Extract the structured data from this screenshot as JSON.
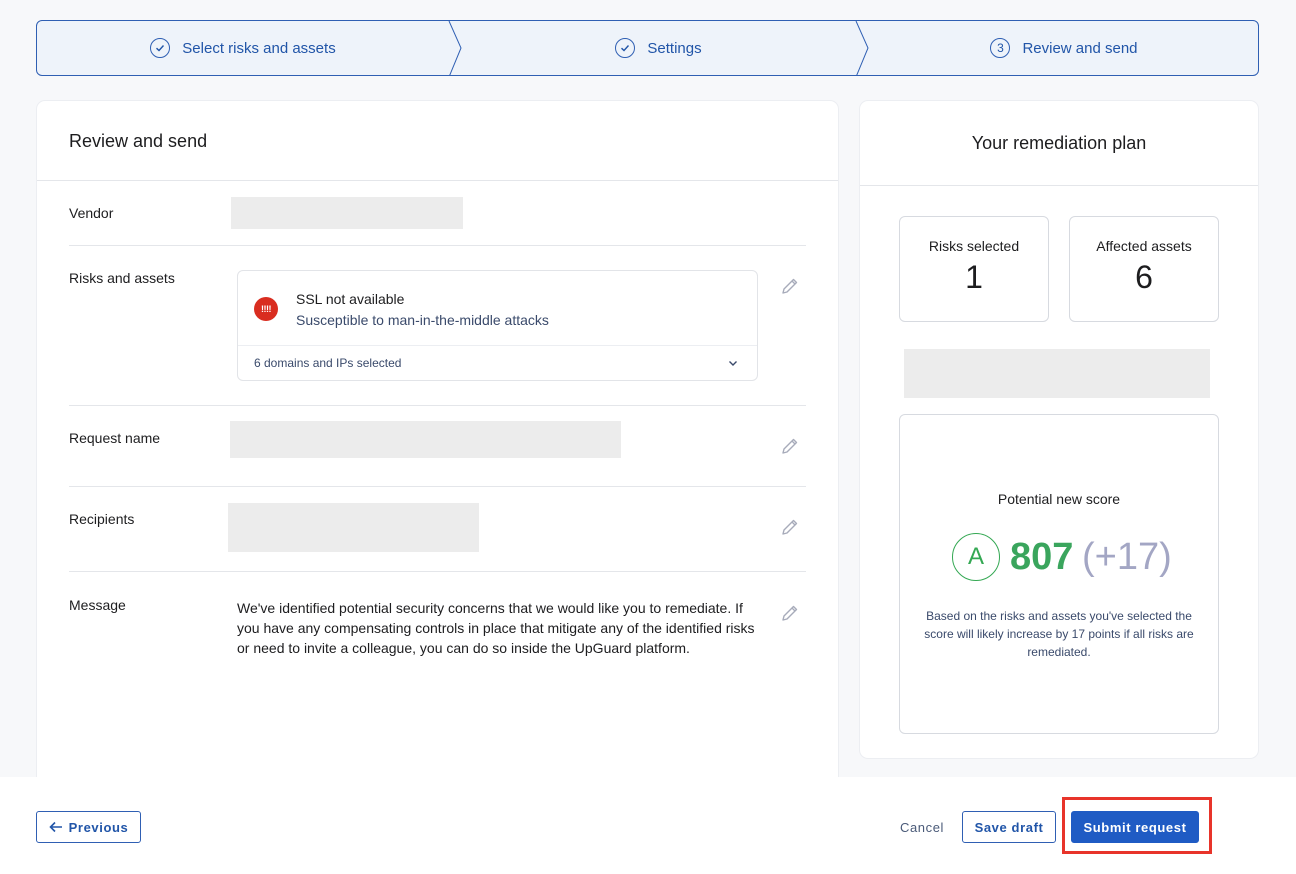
{
  "stepper": {
    "steps": [
      {
        "label": "Select risks and assets",
        "icon": "check-circle-icon"
      },
      {
        "label": "Settings",
        "icon": "check-circle-icon"
      },
      {
        "label": "Review and send",
        "number": "3"
      }
    ]
  },
  "main": {
    "title": "Review and send",
    "rows": {
      "vendor_label": "Vendor",
      "risks_label": "Risks and assets",
      "request_name_label": "Request name",
      "recipients_label": "Recipients",
      "message_label": "Message"
    },
    "risk": {
      "badge": "!!!!",
      "title": "SSL not available",
      "description": "Susceptible to man-in-the-middle attacks",
      "footer": "6 domains and IPs selected"
    },
    "message": "We've identified potential security concerns that we would like you to remediate. If you have any compensating controls in place that mitigate any of the identified risks or need to invite a colleague, you can do so inside the UpGuard platform."
  },
  "side": {
    "title": "Your remediation plan",
    "risks_selected_label": "Risks selected",
    "risks_selected_value": "1",
    "affected_assets_label": "Affected assets",
    "affected_assets_value": "6",
    "score_label": "Potential new score",
    "grade": "A",
    "score": "807",
    "delta": "(+17)",
    "note": "Based on the risks and assets you've selected the score will likely increase by 17 points if all risks are remediated."
  },
  "footer": {
    "previous": "Previous",
    "cancel": "Cancel",
    "save_draft": "Save draft",
    "submit": "Submit request"
  },
  "colors": {
    "accent": "#1f5bc4",
    "score_green": "#3aa55d",
    "risk_red": "#d92d20",
    "highlight_red": "#e8342a"
  }
}
